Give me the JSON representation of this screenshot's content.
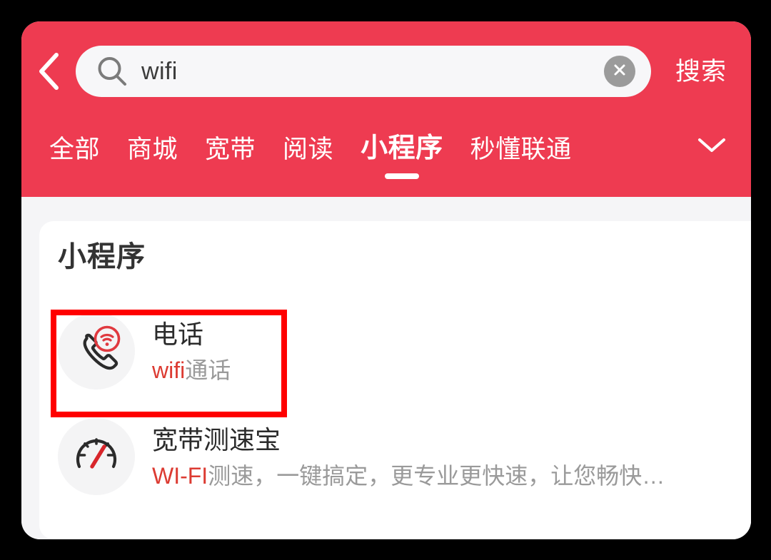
{
  "colors": {
    "header_red": "#ee3b51",
    "highlight_red": "#dc3b32",
    "annotation_red": "#ff0000",
    "page_bg": "#f5f5f7",
    "card_bg": "#ffffff"
  },
  "header": {
    "back_icon": "chevron-left-icon",
    "search": {
      "icon": "search-icon",
      "value": "wifi",
      "placeholder": "搜索",
      "clear_icon": "close-circle-icon"
    },
    "search_button_label": "搜索"
  },
  "tabs": {
    "items": [
      {
        "label": "全部",
        "active": false
      },
      {
        "label": "商城",
        "active": false
      },
      {
        "label": "宽带",
        "active": false
      },
      {
        "label": "阅读",
        "active": false
      },
      {
        "label": "小程序",
        "active": true
      },
      {
        "label": "秒懂联通",
        "active": false
      }
    ],
    "expand_icon": "chevron-down-icon"
  },
  "results": {
    "section_title": "小程序",
    "items": [
      {
        "icon": "phone-wifi-icon",
        "title": "电话",
        "subtitle_highlight": "wifi",
        "subtitle_rest": "通话"
      },
      {
        "icon": "speedometer-icon",
        "title": "宽带测速宝",
        "subtitle_highlight": "WI-FI",
        "subtitle_rest": "测速，一键搞定，更专业更快速，让您畅快…"
      }
    ]
  }
}
